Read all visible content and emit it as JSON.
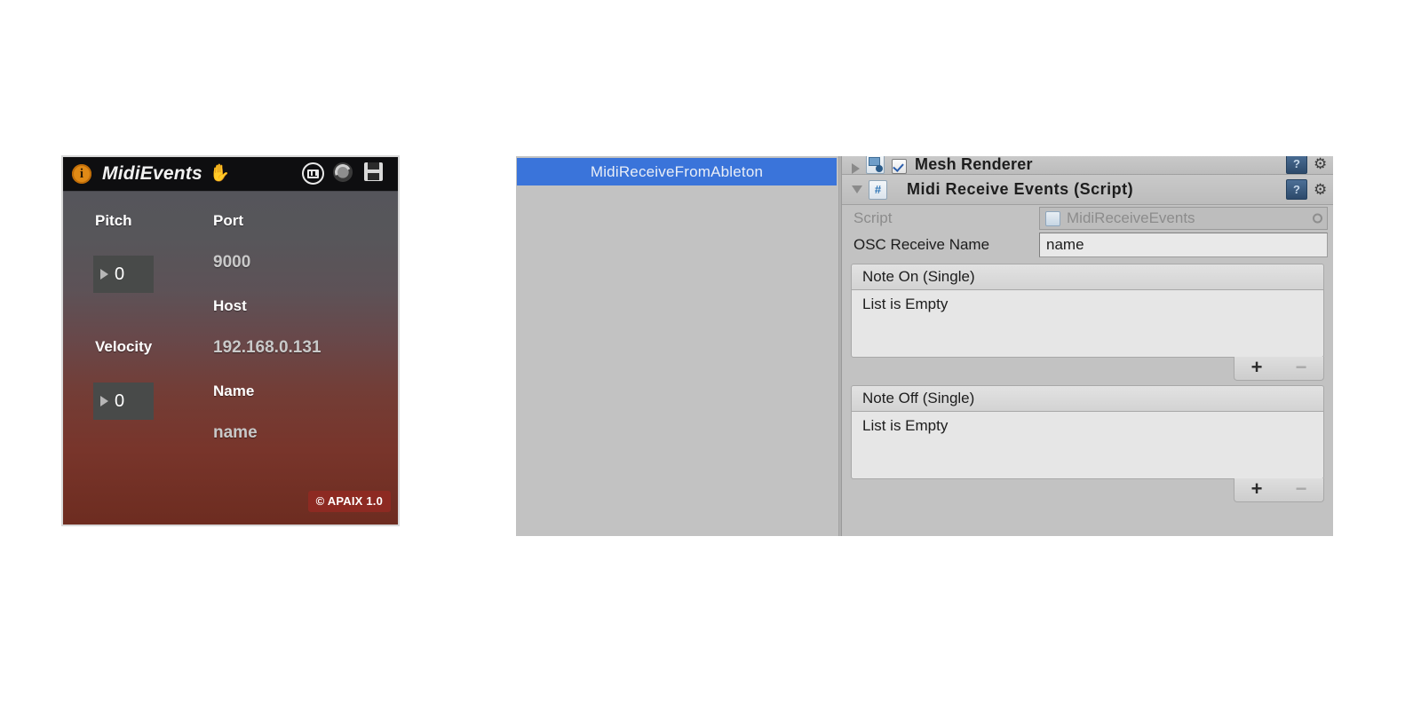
{
  "m4l_device": {
    "title": "MidiEvents",
    "info_badge": "i",
    "hand_icon": "✋",
    "titlebar_buttons": [
      {
        "name": "midi-keyboard-toggle",
        "label": "midi-keyboard"
      },
      {
        "name": "reload-button",
        "label": "reload"
      },
      {
        "name": "save-button",
        "label": "save"
      }
    ],
    "left_column": {
      "pitch_label": "Pitch",
      "pitch_value": "0",
      "velocity_label": "Velocity",
      "velocity_value": "0"
    },
    "right_column": {
      "port_label": "Port",
      "port_value": "9000",
      "host_label": "Host",
      "host_value": "192.168.0.131",
      "name_label": "Name",
      "name_value": "name"
    },
    "copyright_badge": "© APAIX 1.0",
    "colors": {
      "titlebar": "#0e0e10",
      "info_dot": "#e08a16",
      "hand": "#49a7f5",
      "badge_bg": "#8d2a22",
      "field_bg": "#484a49"
    }
  },
  "unity": {
    "hierarchy": {
      "selected_object": "MidiReceiveFromAbleton",
      "selection_color": "#3a74da"
    },
    "inspector": {
      "components": [
        {
          "name": "Mesh Renderer",
          "title": "Mesh Renderer",
          "enabled": true,
          "expanded": false,
          "icon": "mesh-renderer-icon"
        },
        {
          "name": "Midi Receive Events (Script)",
          "title": "Midi Receive Events (Script)",
          "expanded": true,
          "icon": "cs-script-icon"
        }
      ],
      "properties": [
        {
          "label": "Script",
          "value": "MidiReceiveEvents",
          "type": "object-field",
          "disabled": true
        },
        {
          "label": "OSC Receive Name",
          "value": "name",
          "type": "text-field",
          "disabled": false
        }
      ],
      "lists": [
        {
          "header": "Note On (Single)",
          "empty_text": "List is Empty",
          "add_label": "+",
          "remove_label": "−"
        },
        {
          "header": "Note Off (Single)",
          "empty_text": "List is Empty",
          "add_label": "+",
          "remove_label": "−"
        }
      ],
      "help_label": "?",
      "gear_label": "⚙"
    }
  }
}
